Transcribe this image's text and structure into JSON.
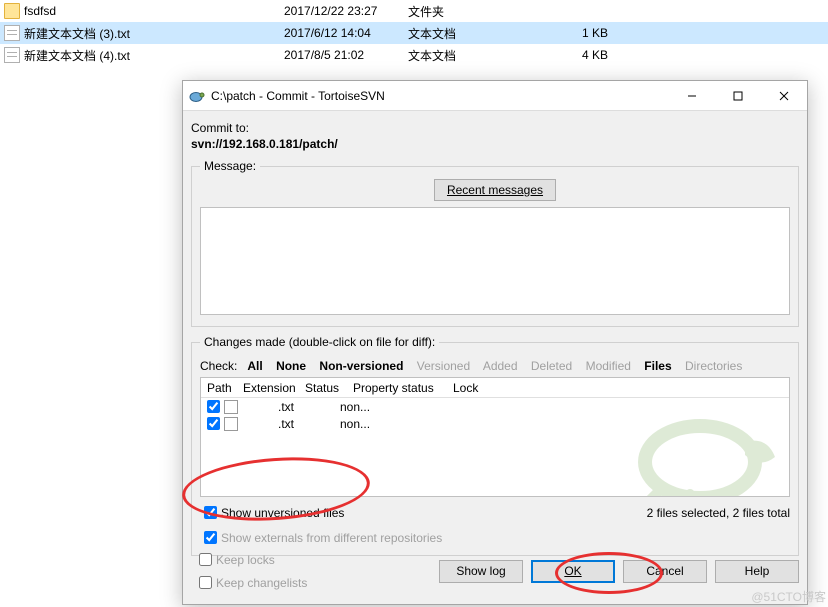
{
  "explorer": {
    "rows": [
      {
        "name": "fsdfsd",
        "date": "2017/12/22 23:27",
        "type": "文件夹",
        "size": ""
      },
      {
        "name": "新建文本文档 (3).txt",
        "date": "2017/6/12 14:04",
        "type": "文本文档",
        "size": "1 KB"
      },
      {
        "name": "新建文本文档 (4).txt",
        "date": "2017/8/5 21:02",
        "type": "文本文档",
        "size": "4 KB"
      }
    ]
  },
  "dialog": {
    "title": "C:\\patch - Commit - TortoiseSVN",
    "commit_to_label": "Commit to:",
    "commit_url": "svn://192.168.0.181/patch/",
    "message_legend": "Message:",
    "recent_btn": "Recent messages",
    "changes_legend": "Changes made (double-click on file for diff):",
    "check_label": "Check:",
    "tabs": {
      "all": "All",
      "none": "None",
      "nonver": "Non-versioned",
      "versioned": "Versioned",
      "added": "Added",
      "deleted": "Deleted",
      "modified": "Modified",
      "files": "Files",
      "dirs": "Directories"
    },
    "cols": {
      "path": "Path",
      "ext": "Extension",
      "status": "Status",
      "prop": "Property status",
      "lock": "Lock"
    },
    "files": [
      {
        "ext": ".txt",
        "status": "non..."
      },
      {
        "ext": ".txt",
        "status": "non..."
      }
    ],
    "show_unversioned": "Show unversioned files",
    "show_externals": "Show externals from different repositories",
    "selection_info": "2 files selected, 2 files total",
    "keep_locks": "Keep locks",
    "keep_changelists": "Keep changelists",
    "buttons": {
      "showlog": "Show log",
      "ok": "OK",
      "cancel": "Cancel",
      "help": "Help"
    }
  },
  "credit": "@51CTO博客"
}
